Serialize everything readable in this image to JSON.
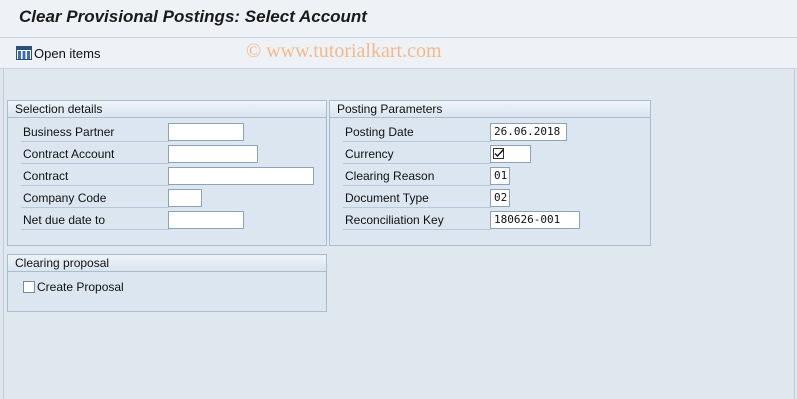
{
  "title": "Clear Provisional Postings: Select Account",
  "toolbar": {
    "open_items_label": "Open items"
  },
  "watermark": "© www.tutorialkart.com",
  "selection": {
    "header": "Selection details",
    "business_partner": {
      "label": "Business Partner",
      "value": ""
    },
    "contract_account": {
      "label": "Contract Account",
      "value": ""
    },
    "contract": {
      "label": "Contract",
      "value": ""
    },
    "company_code": {
      "label": "Company Code",
      "value": ""
    },
    "net_due_date": {
      "label": "Net due date to",
      "value": ""
    }
  },
  "posting": {
    "header": "Posting Parameters",
    "posting_date": {
      "label": "Posting Date",
      "value": "26.06.2018"
    },
    "currency": {
      "label": "Currency",
      "value": ""
    },
    "clearing_reason": {
      "label": "Clearing Reason",
      "value": "01"
    },
    "document_type": {
      "label": "Document Type",
      "value": "02"
    },
    "reconciliation_key": {
      "label": "Reconciliation Key",
      "value": "180626-001"
    }
  },
  "clearing": {
    "header": "Clearing proposal",
    "create_proposal_label": "Create Proposal",
    "create_proposal_checked": false
  }
}
